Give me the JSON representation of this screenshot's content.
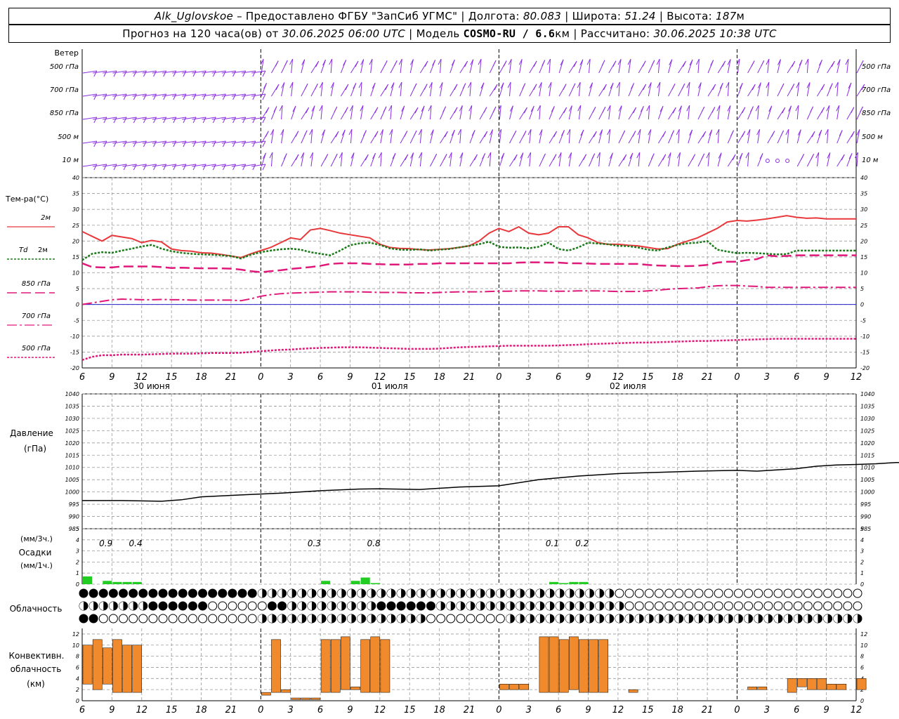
{
  "header": {
    "station": "Alk_Uglovskoe",
    "provider": "– Предоставлено ФГБУ \"ЗапСиб УГМС\"",
    "lon_label": "Долгота:",
    "lon": "80.083",
    "lat_label": "Широта:",
    "lat": "51.24",
    "alt_label": "Высота:",
    "alt": "187",
    "alt_unit": "м",
    "forecast_label": "Прогноз на 120 часа(ов) от",
    "forecast_from": "30.06.2025 06:00 UTC",
    "model_label": "Модель",
    "model": "COSMO-RU / 6.6",
    "model_unit": "км",
    "calc_label": "Рассчитано:",
    "calc_time": "30.06.2025 10:38 UTC",
    "sep": "|"
  },
  "labels": {
    "wind": "Ветер",
    "levels": [
      "500 гПа",
      "700 гПа",
      "850 гПа",
      "500 м",
      "10 м"
    ],
    "temp": "Тем-ра(°C)",
    "t2m": "2м",
    "td": "Td",
    "td2m": "2м",
    "t850": "850 гПа",
    "t700": "700 гПа",
    "t500": "500 гПа",
    "pressure": "Давление",
    "pressure_unit": "(гПа)",
    "precip_3h": "(мм/3ч.)",
    "precip": "Осадки",
    "precip_1h": "(мм/1ч.)",
    "cloud": "Облачность",
    "conv1": "Конвективн.",
    "conv2": "облачность",
    "conv3": "(км)"
  },
  "colors": {
    "t2m": "#e8383c",
    "td": "#1a7a1a",
    "t850": "#e0187a",
    "wind": "#8a2be2",
    "precip": "#22cc22",
    "conv": "#f08a2c",
    "zero_line": "#2222cc"
  },
  "chart_data": [
    {
      "type": "line",
      "name": "temperature",
      "x_hours": [
        0,
        1,
        2,
        3,
        4,
        5,
        6,
        7,
        8,
        9,
        10,
        11,
        12,
        13,
        14,
        15,
        16,
        17,
        18,
        19,
        20,
        21,
        22,
        23,
        24,
        25,
        26,
        27,
        28,
        29,
        30,
        31,
        32,
        33,
        34,
        35,
        36,
        37,
        38,
        39,
        40,
        41,
        42,
        43,
        44,
        45,
        46,
        47,
        48,
        49,
        50,
        51,
        52,
        53,
        54,
        55,
        56,
        57,
        58,
        59,
        60,
        61,
        62,
        63,
        64,
        65,
        66,
        67,
        68,
        69,
        70,
        71,
        72,
        73,
        74,
        75,
        76,
        77,
        78,
        79,
        80,
        81,
        82,
        83,
        84,
        85,
        86
      ],
      "ylim": [
        -20,
        40
      ],
      "yticks": [
        -20,
        -15,
        -10,
        -5,
        0,
        5,
        10,
        15,
        20,
        25,
        30,
        35,
        40
      ],
      "series": [
        {
          "key": "t2m",
          "values": [
            23,
            21.5,
            20,
            21.8,
            21.3,
            20.8,
            19.5,
            20.2,
            19.7,
            17.5,
            17,
            16.8,
            16.3,
            16.2,
            15.8,
            15.3,
            14.8,
            16,
            17,
            18,
            19.5,
            21,
            20.5,
            23.5,
            24,
            23.3,
            22.5,
            22,
            21.5,
            21,
            19,
            18,
            17.7,
            17.6,
            17.3,
            17.2,
            17.4,
            17.6,
            18,
            18.5,
            20,
            22.5,
            24,
            23,
            24.5,
            22.5,
            22,
            22.5,
            24.5,
            24.5,
            22,
            21,
            19.5,
            19,
            19,
            18.7,
            18.5,
            18,
            17.5,
            17.6,
            19,
            20,
            21,
            22.5,
            24,
            26,
            26.5,
            26.3,
            26.6,
            27,
            27.5,
            28,
            27.5,
            27.2,
            27.3,
            27,
            27,
            27,
            27,
            27,
            27,
            27,
            27,
            27,
            27,
            27,
            27
          ]
        },
        {
          "key": "td",
          "values": [
            14,
            16,
            16.5,
            16.3,
            17,
            17.6,
            18.3,
            18.8,
            17.6,
            16.8,
            16.3,
            16,
            15.8,
            15.7,
            15.5,
            15.3,
            14.5,
            15.7,
            16.5,
            17,
            17.4,
            17.6,
            17.3,
            16.5,
            16,
            15.5,
            17,
            18.7,
            19.3,
            19.5,
            18.8,
            17.7,
            17.3,
            17.2,
            17.4,
            17,
            17.3,
            17.5,
            18,
            18.5,
            19,
            19.8,
            18.2,
            17.9,
            18,
            17.7,
            18.2,
            19.5,
            17.5,
            17,
            18,
            19.5,
            19.2,
            19,
            18.5,
            18.4,
            18,
            17.3,
            17,
            18,
            18.8,
            19.3,
            19.5,
            20,
            17.3,
            16.7,
            16.2,
            16.3,
            16.2,
            16,
            15.8,
            15.9,
            17,
            17,
            17,
            17,
            17,
            17,
            17,
            17,
            17,
            17,
            17,
            17,
            17,
            17,
            17
          ]
        },
        {
          "key": "t850",
          "values": [
            13,
            11.8,
            11.7,
            11.7,
            12,
            12,
            12,
            12,
            11.8,
            11.5,
            11.6,
            11.5,
            11.4,
            11.4,
            11.4,
            11.3,
            11,
            10.5,
            10.2,
            10.5,
            10.8,
            11.2,
            11.5,
            11.8,
            12.2,
            12.8,
            13,
            13,
            13,
            12.8,
            12.7,
            12.6,
            12.6,
            12.6,
            12.8,
            12.8,
            13,
            13,
            13,
            13,
            13,
            13,
            13,
            13,
            13.2,
            13.3,
            13.3,
            13.2,
            13.2,
            13,
            13,
            12.9,
            12.8,
            12.8,
            12.8,
            12.8,
            12.8,
            12.5,
            12.3,
            12.2,
            12.1,
            12.1,
            12.2,
            12.5,
            13.2,
            13.5,
            13.5,
            14,
            14.3,
            15.5,
            15.2,
            15.3,
            15.5,
            15.5,
            15.5,
            15.5,
            15.5,
            15.5,
            15.5,
            15.5,
            15.5,
            15.5,
            15.5,
            15.5,
            15.5,
            15.5,
            15.5
          ]
        },
        {
          "key": "t700",
          "values": [
            0,
            0.5,
            1,
            1.5,
            1.7,
            1.6,
            1.5,
            1.5,
            1.6,
            1.5,
            1.5,
            1.4,
            1.4,
            1.4,
            1.4,
            1.4,
            1.2,
            1.8,
            2.6,
            3.1,
            3.4,
            3.6,
            3.7,
            3.8,
            3.9,
            4,
            4,
            4,
            4,
            3.9,
            3.8,
            3.8,
            3.8,
            3.7,
            3.7,
            3.7,
            3.8,
            3.9,
            4,
            4,
            4,
            4.1,
            4.2,
            4.2,
            4.3,
            4.3,
            4.3,
            4.2,
            4.2,
            4.2,
            4.3,
            4.3,
            4.3,
            4.2,
            4.1,
            4.1,
            4.1,
            4.3,
            4.5,
            4.8,
            5,
            5.1,
            5.2,
            5.6,
            5.9,
            6,
            6,
            5.8,
            5.7,
            5.4,
            5.4,
            5.4,
            5.4,
            5.4,
            5.4,
            5.4,
            5.4,
            5.4,
            5.4,
            5.4,
            5.4,
            5.4,
            5.4,
            5.4,
            5.4,
            5.4,
            5.4
          ]
        },
        {
          "key": "t500",
          "values": [
            -17.5,
            -16.5,
            -16,
            -16,
            -15.8,
            -15.8,
            -15.8,
            -15.7,
            -15.6,
            -15.5,
            -15.5,
            -15.5,
            -15.4,
            -15.3,
            -15.3,
            -15.3,
            -15.2,
            -15,
            -14.7,
            -14.5,
            -14.3,
            -14.2,
            -14,
            -13.8,
            -13.7,
            -13.6,
            -13.5,
            -13.5,
            -13.5,
            -13.6,
            -13.7,
            -13.8,
            -13.9,
            -14,
            -14,
            -14,
            -13.9,
            -13.7,
            -13.5,
            -13.4,
            -13.3,
            -13.2,
            -13.1,
            -13,
            -13,
            -13,
            -13,
            -13,
            -12.9,
            -12.8,
            -12.7,
            -12.5,
            -12.4,
            -12.3,
            -12.2,
            -12.1,
            -12,
            -12,
            -11.9,
            -11.8,
            -11.7,
            -11.6,
            -11.5,
            -11.5,
            -11.4,
            -11.3,
            -11.2,
            -11.1,
            -11,
            -10.9,
            -10.8,
            -10.8,
            -10.8,
            -10.8,
            -10.8,
            -10.8,
            -10.8,
            -10.8,
            -10.8,
            -10.8,
            -10.8,
            -10.8,
            -10.8,
            -10.8,
            -10.8,
            -10.8,
            -10.8
          ]
        }
      ]
    },
    {
      "type": "line",
      "name": "pressure",
      "ylim": [
        985,
        1040
      ],
      "yticks": [
        985,
        990,
        995,
        1000,
        1005,
        1010,
        1015,
        1020,
        1025,
        1030,
        1035,
        1040
      ],
      "x_hours": [
        0,
        4,
        8,
        10,
        12,
        16,
        20,
        24,
        28,
        30,
        34,
        38,
        42,
        46,
        50,
        54,
        58,
        62,
        66,
        68,
        70,
        72,
        74,
        76,
        78,
        80,
        82,
        84,
        86
      ],
      "values": [
        996.5,
        996.5,
        996.2,
        996.8,
        998,
        998.8,
        999.5,
        1000.5,
        1001.2,
        1001.3,
        1001,
        1002,
        1002.5,
        1005,
        1006.5,
        1007.5,
        1008,
        1008.5,
        1008.8,
        1008.5,
        1009,
        1009.5,
        1010.5,
        1011,
        1011.2,
        1011.5,
        1012,
        1012,
        1012.3
      ]
    },
    {
      "type": "bar",
      "name": "precipitation",
      "ylim": [
        0,
        5
      ],
      "yticks": [
        0,
        1,
        2,
        3,
        4,
        5
      ],
      "labels_3h": [
        {
          "hour": 1,
          "text": "0.9"
        },
        {
          "hour": 4,
          "text": "0.4"
        },
        {
          "hour": 22,
          "text": "0.3"
        },
        {
          "hour": 28,
          "text": "0.8"
        },
        {
          "hour": 46,
          "text": "0.1"
        },
        {
          "hour": 49,
          "text": "0.2"
        }
      ],
      "bars_1h": [
        {
          "hour": 0,
          "value": 0.7
        },
        {
          "hour": 2,
          "value": 0.3
        },
        {
          "hour": 3,
          "value": 0.2
        },
        {
          "hour": 4,
          "value": 0.2
        },
        {
          "hour": 5,
          "value": 0.2
        },
        {
          "hour": 24,
          "value": 0.3
        },
        {
          "hour": 27,
          "value": 0.3
        },
        {
          "hour": 28,
          "value": 0.6
        },
        {
          "hour": 29,
          "value": 0.1
        },
        {
          "hour": 47,
          "value": 0.2
        },
        {
          "hour": 48,
          "value": 0.1
        },
        {
          "hour": 49,
          "value": 0.2
        },
        {
          "hour": 50,
          "value": 0.2
        }
      ]
    },
    {
      "type": "bar",
      "name": "convective_cloud",
      "ylim": [
        0,
        13
      ],
      "yticks": [
        0,
        2,
        4,
        6,
        8,
        10,
        12
      ],
      "bars": [
        {
          "hour": 0,
          "base": 3,
          "top": 10
        },
        {
          "hour": 1,
          "base": 2,
          "top": 11
        },
        {
          "hour": 2,
          "base": 3,
          "top": 9.5
        },
        {
          "hour": 3,
          "base": 1.5,
          "top": 11
        },
        {
          "hour": 4,
          "base": 1.5,
          "top": 10
        },
        {
          "hour": 5,
          "base": 1.5,
          "top": 10
        },
        {
          "hour": 18,
          "base": 1,
          "top": 1.5
        },
        {
          "hour": 19,
          "base": 1.5,
          "top": 11
        },
        {
          "hour": 20,
          "base": 1.5,
          "top": 2
        },
        {
          "hour": 21,
          "base": 0.2,
          "top": 0.5
        },
        {
          "hour": 22,
          "base": 0.2,
          "top": 0.5
        },
        {
          "hour": 23,
          "base": 0.2,
          "top": 0.5
        },
        {
          "hour": 24,
          "base": 1.5,
          "top": 11
        },
        {
          "hour": 25,
          "base": 1.5,
          "top": 11
        },
        {
          "hour": 26,
          "base": 2,
          "top": 11.5
        },
        {
          "hour": 27,
          "base": 2,
          "top": 2.5
        },
        {
          "hour": 28,
          "base": 1.5,
          "top": 11
        },
        {
          "hour": 29,
          "base": 1.5,
          "top": 11.5
        },
        {
          "hour": 30,
          "base": 1.5,
          "top": 11
        },
        {
          "hour": 42,
          "base": 2,
          "top": 3
        },
        {
          "hour": 43,
          "base": 2,
          "top": 3
        },
        {
          "hour": 44,
          "base": 2,
          "top": 3
        },
        {
          "hour": 46,
          "base": 1.5,
          "top": 11.5
        },
        {
          "hour": 47,
          "base": 1.5,
          "top": 11.5
        },
        {
          "hour": 48,
          "base": 1.5,
          "top": 11
        },
        {
          "hour": 49,
          "base": 2,
          "top": 11.5
        },
        {
          "hour": 50,
          "base": 1.5,
          "top": 11
        },
        {
          "hour": 51,
          "base": 1.5,
          "top": 11
        },
        {
          "hour": 52,
          "base": 1.5,
          "top": 11
        },
        {
          "hour": 55,
          "base": 1.5,
          "top": 2
        },
        {
          "hour": 67,
          "base": 2,
          "top": 2.5
        },
        {
          "hour": 68,
          "base": 2,
          "top": 2.5
        },
        {
          "hour": 71,
          "base": 1.5,
          "top": 4
        },
        {
          "hour": 72,
          "base": 2.5,
          "top": 4
        },
        {
          "hour": 73,
          "base": 2,
          "top": 4
        },
        {
          "hour": 74,
          "base": 2,
          "top": 4
        },
        {
          "hour": 75,
          "base": 2,
          "top": 3
        },
        {
          "hour": 76,
          "base": 2,
          "top": 3
        },
        {
          "hour": 78,
          "base": 2,
          "top": 4
        }
      ]
    }
  ],
  "axes": {
    "hour_ticks": [
      {
        "h": 0,
        "t": "6"
      },
      {
        "h": 3,
        "t": "9"
      },
      {
        "h": 6,
        "t": "12"
      },
      {
        "h": 9,
        "t": "15"
      },
      {
        "h": 12,
        "t": "18"
      },
      {
        "h": 15,
        "t": "21"
      },
      {
        "h": 18,
        "t": "0"
      },
      {
        "h": 21,
        "t": "3"
      },
      {
        "h": 24,
        "t": "6"
      },
      {
        "h": 27,
        "t": "9"
      },
      {
        "h": 30,
        "t": "12"
      },
      {
        "h": 33,
        "t": "15"
      },
      {
        "h": 36,
        "t": "18"
      },
      {
        "h": 39,
        "t": "21"
      },
      {
        "h": 42,
        "t": "0"
      },
      {
        "h": 45,
        "t": "3"
      },
      {
        "h": 48,
        "t": "6"
      },
      {
        "h": 51,
        "t": "9"
      },
      {
        "h": 54,
        "t": "12"
      },
      {
        "h": 57,
        "t": "15"
      },
      {
        "h": 60,
        "t": "18"
      },
      {
        "h": 63,
        "t": "21"
      },
      {
        "h": 66,
        "t": "0"
      },
      {
        "h": 69,
        "t": "3"
      },
      {
        "h": 72,
        "t": "6"
      },
      {
        "h": 75,
        "t": "9"
      },
      {
        "h": 78,
        "t": "12"
      }
    ],
    "days": [
      {
        "h": 6,
        "t": "30 июня"
      },
      {
        "h": 30,
        "t": "01 июля"
      },
      {
        "h": 54,
        "t": "02 июля"
      }
    ],
    "midnights": [
      18,
      42,
      66
    ]
  },
  "cloud_rows": [
    "pppppppppppppppppphhhhhhhhhhhhhhhhhhhhhhhhhhhhhhhhhhhhoooooooooooooooooooooooooo",
    "hhhhhhhppppppoooooopphhhhhhhhhpppppphhhhhhhhhhhhhhhhhhhoooooooooooooooooooooooo",
    "ppoooooooooooooooohhhhhhhhhhhhhhhhhoooooooohhhhhhhhhhhhhhhhhhhhhhhhhhhhhhhhhhhhpo"
  ]
}
